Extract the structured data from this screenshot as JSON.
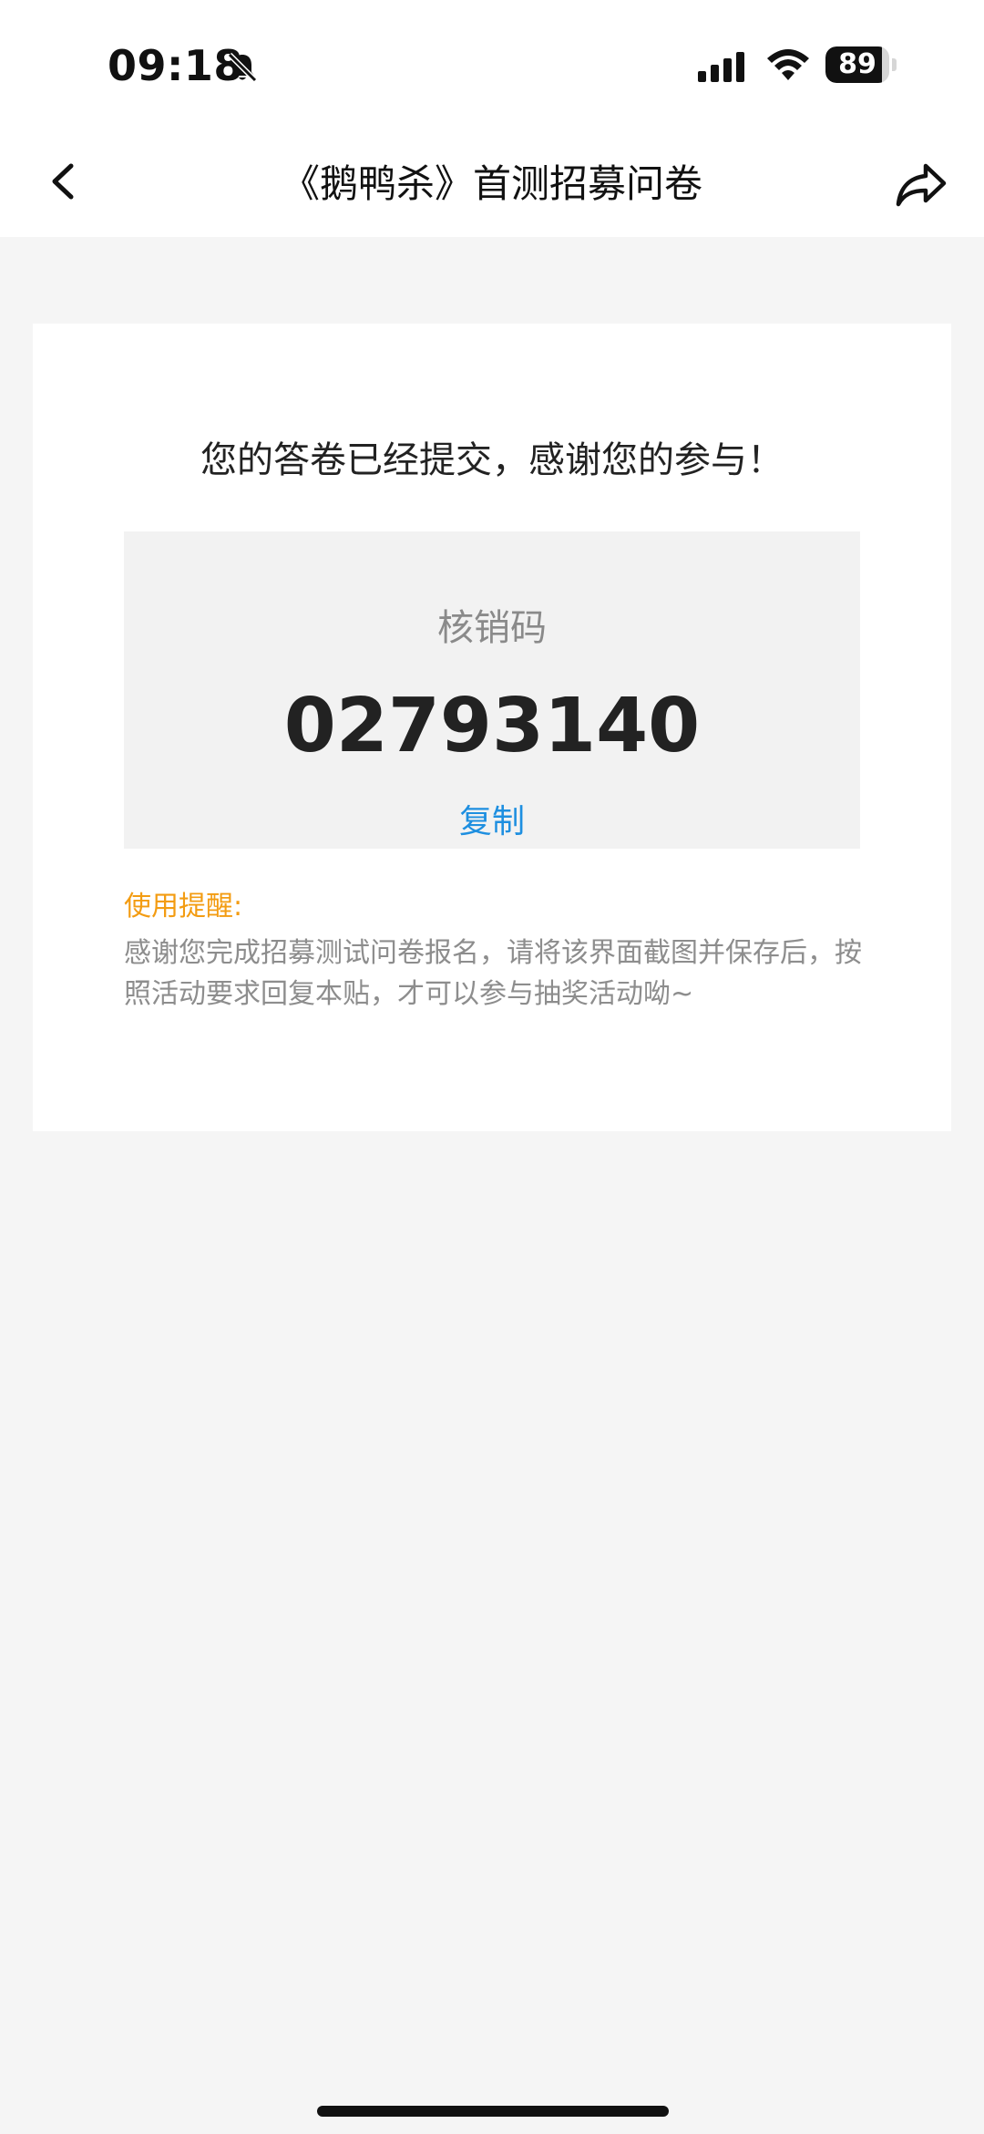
{
  "status_bar": {
    "time": "09:18",
    "battery_level": "89",
    "battery_fraction": 0.89
  },
  "nav": {
    "title": "《鹅鸭杀》首测招募问卷"
  },
  "card": {
    "message": "您的答卷已经提交，感谢您的参与！",
    "code_label": "核销码",
    "code_value": "02793140",
    "copy_label": "复制",
    "tip_label": "使用提醒:",
    "tip_text": "感谢您完成招募测试问卷报名，请将该界面截图并保存后，按照活动要求回复本贴，才可以参与抽奖活动呦~"
  },
  "colors": {
    "background": "#f5f5f5",
    "card": "#ffffff",
    "code_box": "#f2f2f2",
    "link_blue": "#1e8fe0",
    "tip_orange": "#f39c12",
    "muted_text": "#8d8d8d"
  },
  "icons": {
    "bell": "bell-slash-icon",
    "signal": "cellular-signal-icon",
    "wifi": "wifi-icon",
    "back": "chevron-left-icon",
    "share": "share-forward-icon"
  }
}
